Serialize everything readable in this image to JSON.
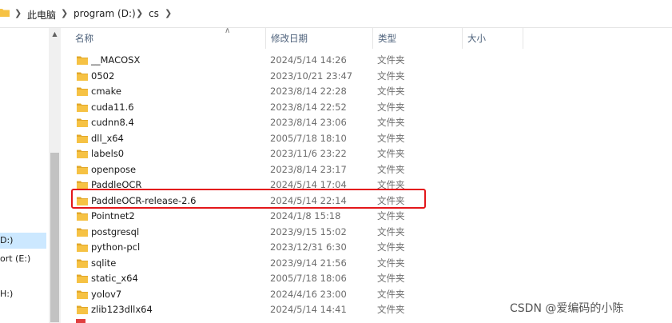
{
  "breadcrumb": {
    "items": [
      "此电脑",
      "program (D:)",
      "cs"
    ]
  },
  "nav": {
    "items": [
      {
        "label": "D:)",
        "selected": true
      },
      {
        "label": "ort (E:)",
        "selected": false
      },
      {
        "label": "H:)",
        "selected": false
      }
    ]
  },
  "columns": {
    "name": "名称",
    "date": "修改日期",
    "type": "类型",
    "size": "大小"
  },
  "files": [
    {
      "name": "__MACOSX",
      "date": "2024/5/14 14:26",
      "type": "文件夹"
    },
    {
      "name": "0502",
      "date": "2023/10/21 23:47",
      "type": "文件夹"
    },
    {
      "name": "cmake",
      "date": "2023/8/14 22:28",
      "type": "文件夹"
    },
    {
      "name": "cuda11.6",
      "date": "2023/8/14 22:52",
      "type": "文件夹"
    },
    {
      "name": "cudnn8.4",
      "date": "2023/8/14 23:06",
      "type": "文件夹"
    },
    {
      "name": "dll_x64",
      "date": "2005/7/18 18:10",
      "type": "文件夹"
    },
    {
      "name": "labels0",
      "date": "2023/11/6 23:22",
      "type": "文件夹"
    },
    {
      "name": "openpose",
      "date": "2023/8/14 23:17",
      "type": "文件夹"
    },
    {
      "name": "PaddleOCR",
      "date": "2024/5/14 17:04",
      "type": "文件夹"
    },
    {
      "name": "PaddleOCR-release-2.6",
      "date": "2024/5/14 22:14",
      "type": "文件夹"
    },
    {
      "name": "Pointnet2",
      "date": "2024/1/8 15:18",
      "type": "文件夹"
    },
    {
      "name": "postgresql",
      "date": "2023/9/15 15:02",
      "type": "文件夹"
    },
    {
      "name": "python-pcl",
      "date": "2023/12/31 6:30",
      "type": "文件夹"
    },
    {
      "name": "sqlite",
      "date": "2023/9/14 21:56",
      "type": "文件夹"
    },
    {
      "name": "static_x64",
      "date": "2005/7/18 18:06",
      "type": "文件夹"
    },
    {
      "name": "yolov7",
      "date": "2024/4/16 23:00",
      "type": "文件夹"
    },
    {
      "name": "zlib123dllx64",
      "date": "2024/5/14 14:41",
      "type": "文件夹"
    }
  ],
  "highlighted_item": "PaddleOCR-release-2.6",
  "watermark": "CSDN @爱编码的小陈",
  "colors": {
    "folder": "#f6c244",
    "folder_dark": "#e2a82a",
    "highlight_border": "#e3171b",
    "selection": "#cce8ff"
  },
  "icons": {
    "folder": "folder-icon",
    "separator": "chevron-right-icon",
    "sort": "sort-up-icon"
  }
}
